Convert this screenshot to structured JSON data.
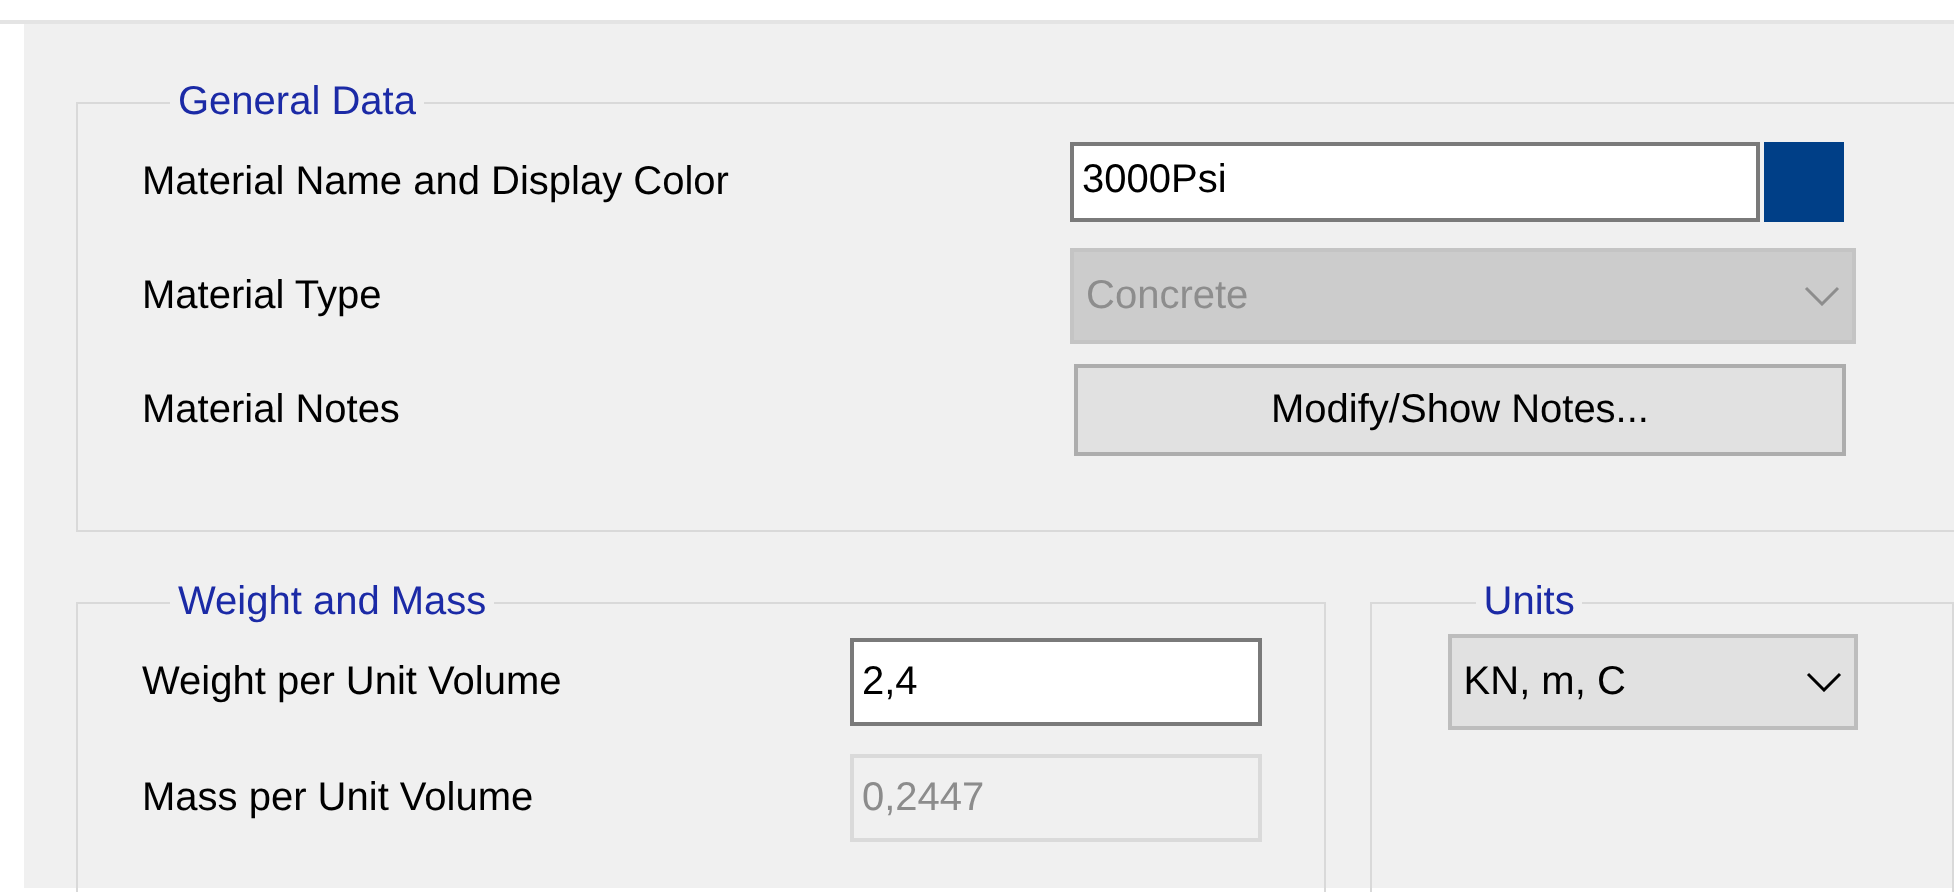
{
  "general_data": {
    "title": "General Data",
    "material_name": {
      "label": "Material Name and Display Color",
      "value": "3000Psi",
      "color": "#003f87"
    },
    "material_type": {
      "label": "Material Type",
      "value": "Concrete",
      "disabled": true
    },
    "material_notes": {
      "label": "Material Notes",
      "button": "Modify/Show Notes..."
    }
  },
  "weight_and_mass": {
    "title": "Weight and Mass",
    "fields": [
      {
        "label": "Weight per Unit Volume",
        "value": "2,4",
        "disabled": false
      },
      {
        "label": "Mass per Unit Volume",
        "value": "0,2447",
        "disabled": true
      }
    ]
  },
  "units": {
    "title": "Units",
    "value": "KN, m, C"
  }
}
